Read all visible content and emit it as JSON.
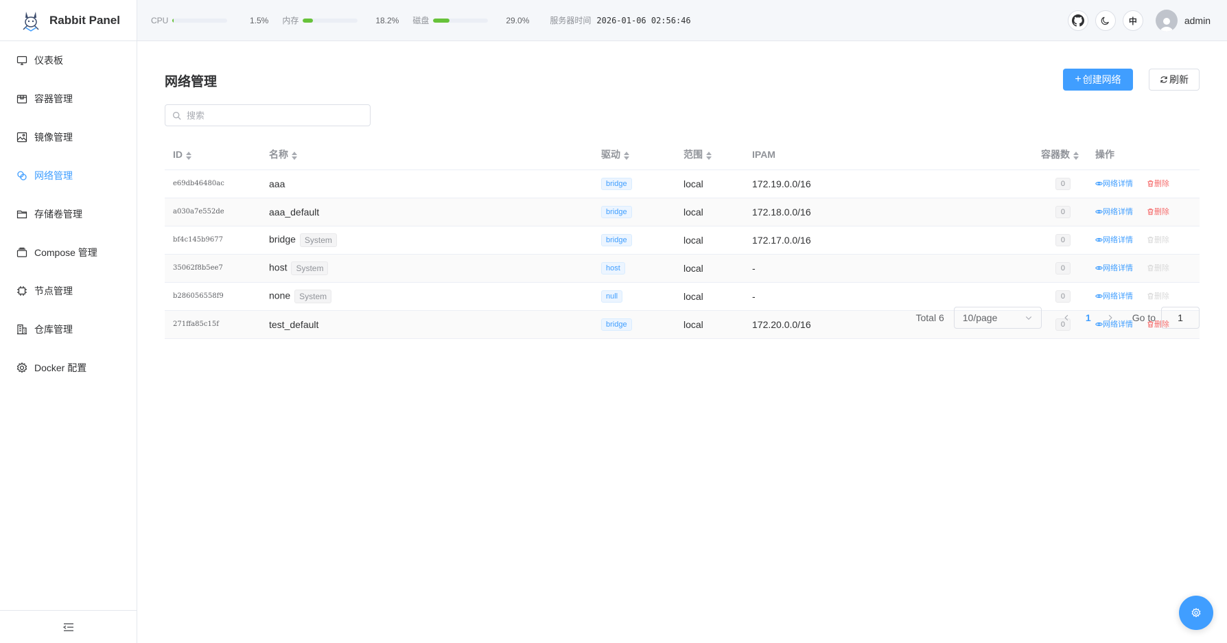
{
  "brand": {
    "name": "Rabbit Panel"
  },
  "sidebar": {
    "items": [
      {
        "label": "仪表板",
        "icon": "monitor-icon"
      },
      {
        "label": "容器管理",
        "icon": "box-icon"
      },
      {
        "label": "镜像管理",
        "icon": "picture-icon"
      },
      {
        "label": "网络管理",
        "icon": "link-icon"
      },
      {
        "label": "存储卷管理",
        "icon": "folder-icon"
      },
      {
        "label": "Compose 管理",
        "icon": "layers-icon"
      },
      {
        "label": "节点管理",
        "icon": "cpu-icon"
      },
      {
        "label": "仓库管理",
        "icon": "building-icon"
      },
      {
        "label": "Docker 配置",
        "icon": "gear-icon"
      }
    ]
  },
  "header": {
    "stats": [
      {
        "label": "CPU",
        "value": "1.5%",
        "percent": 1.5
      },
      {
        "label": "内存",
        "value": "18.2%",
        "percent": 18.2
      },
      {
        "label": "磁盘",
        "value": "29.0%",
        "percent": 29.0
      }
    ],
    "server_time_label": "服务器时间",
    "server_time": "2026-01-06 02:56:46",
    "lang": "中",
    "username": "admin"
  },
  "page": {
    "title": "网络管理",
    "create_label": "创建网络",
    "refresh_label": "刷新",
    "search_placeholder": "搜索"
  },
  "table": {
    "headers": {
      "id": "ID",
      "name": "名称",
      "driver": "驱动",
      "scope": "范围",
      "ipam": "IPAM",
      "containers": "容器数",
      "actions": "操作"
    },
    "rows": [
      {
        "id": "e69db46480ac",
        "name": "aaa",
        "system": "",
        "driver": "bridge",
        "scope": "local",
        "ipam": "172.19.0.0/16",
        "containers": "0",
        "view": "网络详情",
        "delete": "删除"
      },
      {
        "id": "a030a7e552de",
        "name": "aaa_default",
        "system": "",
        "driver": "bridge",
        "scope": "local",
        "ipam": "172.18.0.0/16",
        "containers": "0",
        "view": "网络详情",
        "delete": "删除"
      },
      {
        "id": "bf4c145b9677",
        "name": "bridge",
        "system": "System",
        "driver": "bridge",
        "scope": "local",
        "ipam": "172.17.0.0/16",
        "containers": "0",
        "view": "网络详情",
        "delete": "删除"
      },
      {
        "id": "35062f8b5ee7",
        "name": "host",
        "system": "System",
        "driver": "host",
        "scope": "local",
        "ipam": "-",
        "containers": "0",
        "view": "网络详情",
        "delete": "删除"
      },
      {
        "id": "b286056558f9",
        "name": "none",
        "system": "System",
        "driver": "null",
        "scope": "local",
        "ipam": "-",
        "containers": "0",
        "view": "网络详情",
        "delete": "删除"
      },
      {
        "id": "271ffa85c15f",
        "name": "test_default",
        "system": "",
        "driver": "bridge",
        "scope": "local",
        "ipam": "172.20.0.0/16",
        "containers": "0",
        "view": "网络详情",
        "delete": "删除"
      }
    ]
  },
  "pagination": {
    "total": "Total 6",
    "page_size": "10/page",
    "current": "1",
    "goto_label": "Go to",
    "goto_value": "1"
  },
  "colors": {
    "accent": "#409eff",
    "danger": "#f56c6c",
    "success": "#67c23a"
  }
}
